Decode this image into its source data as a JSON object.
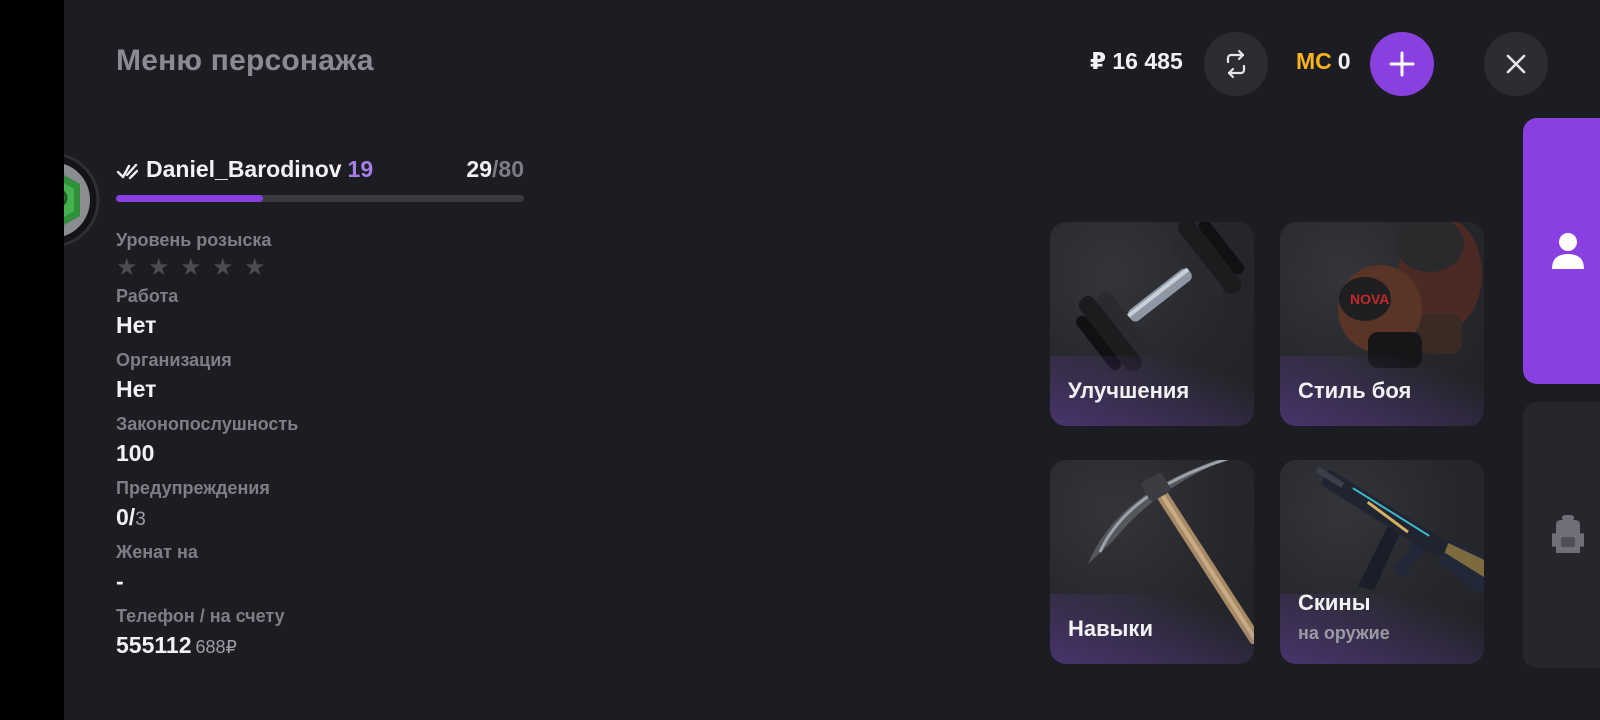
{
  "header": {
    "title": "Меню персонажа",
    "money": "₽ 16 485",
    "mc_label": "MC",
    "mc_value": "0"
  },
  "player": {
    "name": "Daniel_Barodinov",
    "level": "19",
    "exp_current": "29",
    "exp_max": "/80",
    "exp_progress_fraction": 0.36
  },
  "info": {
    "wanted_label": "Уровень розыска",
    "wanted_stars_total": 5,
    "wanted_stars_filled": 0,
    "job_label": "Работа",
    "job_value": "Нет",
    "org_label": "Организация",
    "org_value": "Нет",
    "law_label": "Законопослушность",
    "law_value": "100",
    "warnings_label": "Предупреждения",
    "warnings_value": "0/",
    "warnings_max": "3",
    "married_label": "Женат на",
    "married_value": "-",
    "phone_label": "Телефон / на счету",
    "phone_value": "555112",
    "phone_balance": "688₽"
  },
  "tiles": {
    "upgrades": "Улучшения",
    "fight_style": "Стиль боя",
    "skills": "Навыки",
    "skins": "Скины",
    "skins_sub": "на оружие"
  },
  "icons": {
    "swap": "swap-arrows-icon",
    "plus": "plus-icon",
    "close": "close-icon",
    "verified": "verified-check-icon",
    "star": "star-icon",
    "profile": "person-icon",
    "inventory": "backpack-icon"
  },
  "colors": {
    "accent": "#8a3fe0",
    "level": "#a77ee9",
    "mc": "#f7b21e",
    "background": "#1c1d22"
  }
}
